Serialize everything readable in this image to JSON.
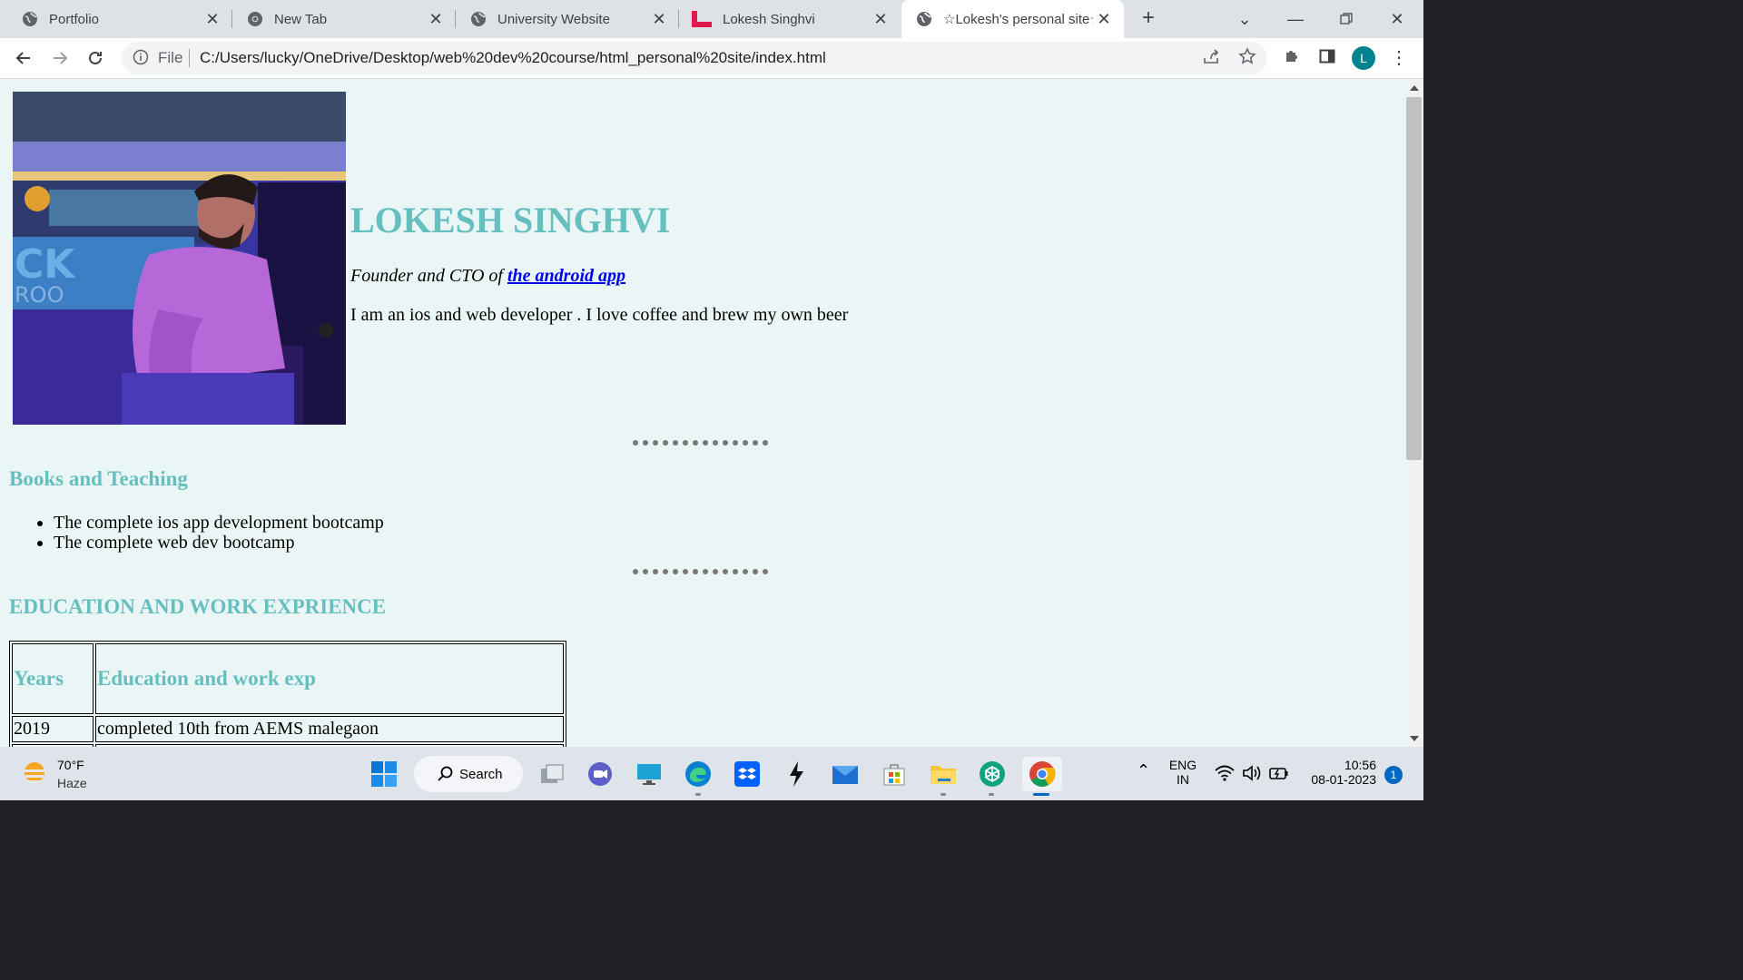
{
  "browser": {
    "tabs": [
      {
        "title": "Portfolio",
        "icon": "globe-icon"
      },
      {
        "title": "New Tab",
        "icon": "chrome-icon"
      },
      {
        "title": "University Website",
        "icon": "globe-icon"
      },
      {
        "title": "Lokesh Singhvi",
        "icon": "l-logo-icon"
      },
      {
        "title": "☆Lokesh's personal site☆",
        "icon": "globe-icon",
        "active": true
      }
    ],
    "address": {
      "scheme_label": "File",
      "url": "C:/Users/lucky/OneDrive/Desktop/web%20dev%20course/html_personal%20site/index.html"
    },
    "profile_initial": "L"
  },
  "page": {
    "name": "LOKESH SINGHVI",
    "founder_prefix": "Founder and CTO of ",
    "founder_link": "the android app",
    "bio": "I am an ios and web developer . I love coffee and brew my own beer",
    "books_heading": "Books and Teaching",
    "books": [
      "The complete ios app development bootcamp",
      "The complete web dev bootcamp"
    ],
    "education_heading": "EDUCATION AND WORK EXPRIENCE",
    "table": {
      "headers": [
        "Years",
        "Education and work exp"
      ],
      "rows": [
        [
          "2019",
          "completed 10th from AEMS malegaon"
        ]
      ]
    },
    "accent_color": "#66bfbf",
    "background_color": "#eaf6f6"
  },
  "taskbar": {
    "weather_temp": "70°F",
    "weather_condition": "Haze",
    "search_label": "Search",
    "language": "ENG",
    "region": "IN",
    "time": "10:56",
    "date": "08-01-2023",
    "notification_count": "1"
  }
}
